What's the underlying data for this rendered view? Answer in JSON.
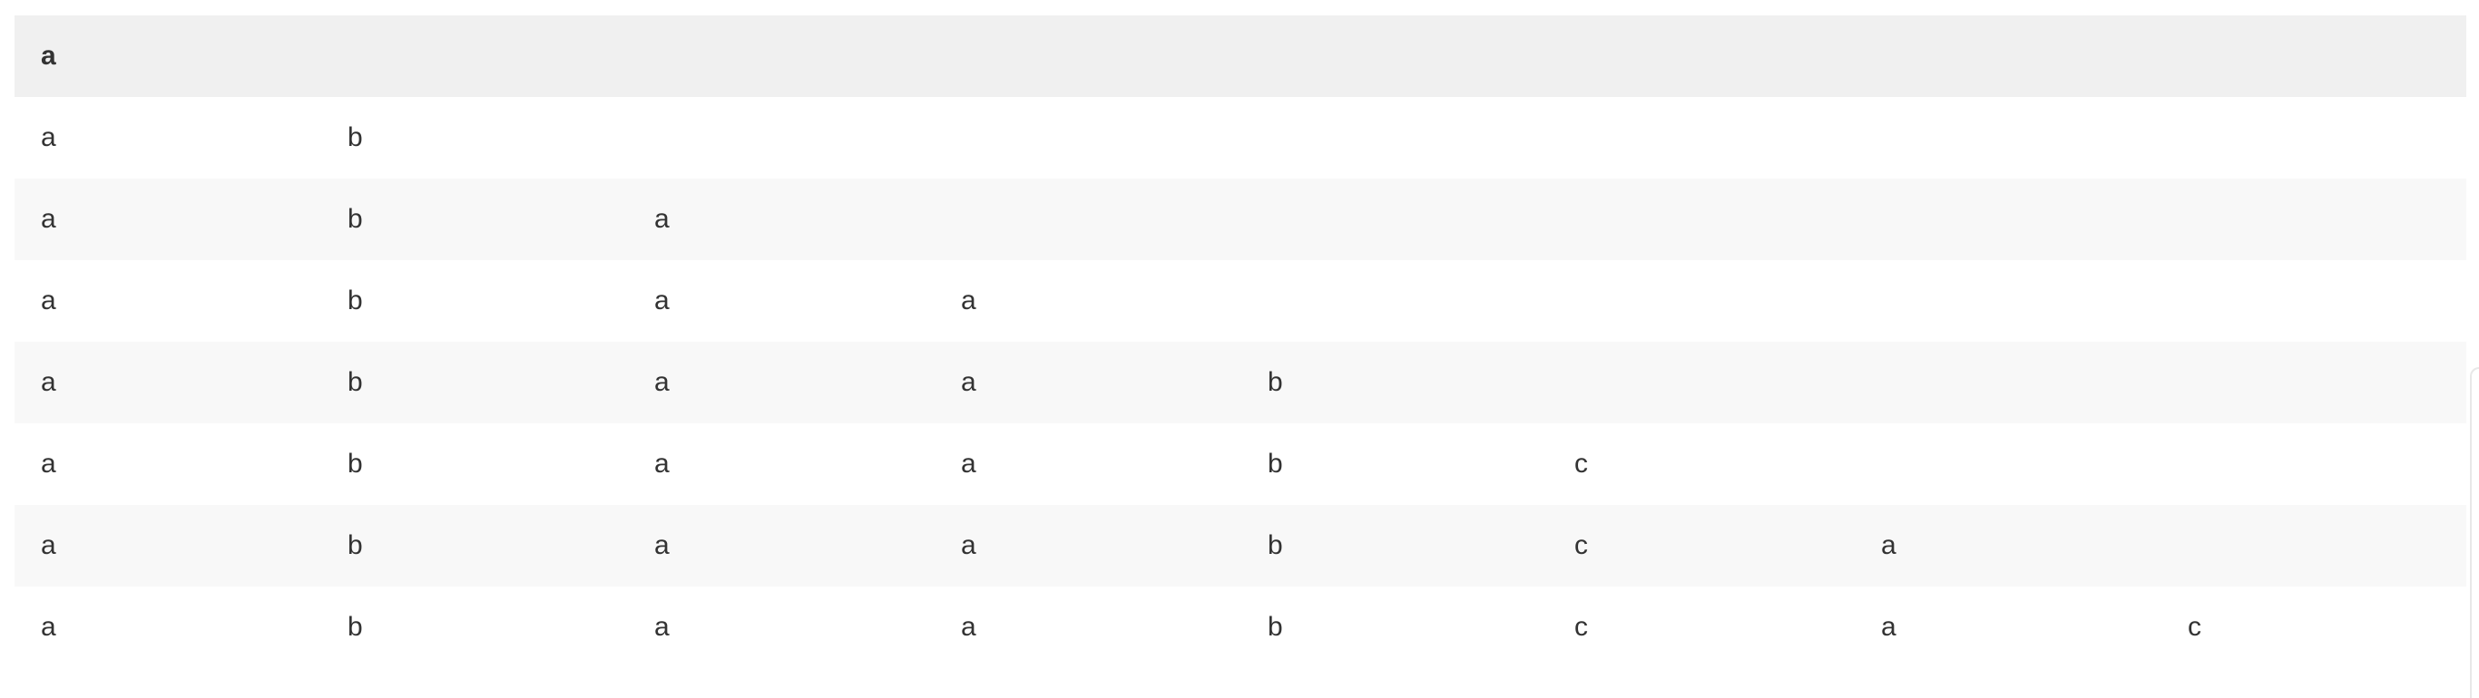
{
  "table": {
    "header": [
      "a"
    ],
    "rows": [
      [
        "a",
        "b"
      ],
      [
        "a",
        "b",
        "a"
      ],
      [
        "a",
        "b",
        "a",
        "a"
      ],
      [
        "a",
        "b",
        "a",
        "a",
        "b"
      ],
      [
        "a",
        "b",
        "a",
        "a",
        "b",
        "c"
      ],
      [
        "a",
        "b",
        "a",
        "a",
        "b",
        "c",
        "a"
      ],
      [
        "a",
        "b",
        "a",
        "a",
        "b",
        "c",
        "a",
        "c"
      ]
    ]
  }
}
